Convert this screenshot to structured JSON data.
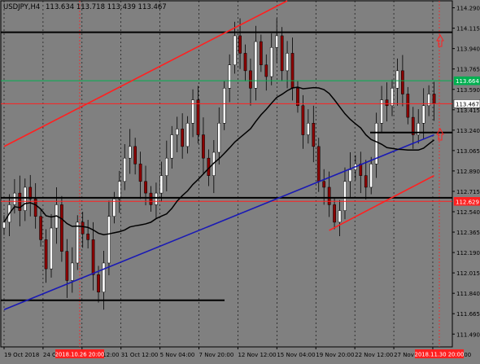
{
  "header": {
    "title": "USDJPY,H4",
    "ohlc": "113.634 113.718 113.439 113.467"
  },
  "chart_data": {
    "type": "candlestick",
    "symbol": "USDJPY",
    "timeframe": "H4",
    "ylim": [
      111.38,
      114.35
    ],
    "y_ticks": [
      "114.290",
      "114.115",
      "113.940",
      "113.765",
      "113.590",
      "113.415",
      "113.240",
      "113.065",
      "112.890",
      "112.715",
      "112.540",
      "112.365",
      "112.190",
      "112.015",
      "111.840",
      "111.665",
      "111.490"
    ],
    "x_ticks": [
      "19 Oct 2018",
      "24 Oct 20:00",
      "29 Oct 12:00",
      "31 Oct 12:00",
      "5 Nov 04:00",
      "7 Nov 20:00",
      "12 Nov 12:00",
      "15 Nov 04:00",
      "19 Nov 20:00",
      "22 Nov 12:00",
      "27 Nov 04:00",
      "29 Nov 20:00"
    ],
    "highlighted_x": [
      "2018.10.26 20:00",
      "2018.11.30 20:00"
    ],
    "price_labels": [
      {
        "value": 113.664,
        "text": "113.664",
        "color": "#00b050"
      },
      {
        "value": 113.467,
        "text": "113.467",
        "color": "#ffffff"
      },
      {
        "value": 112.629,
        "text": "112.629",
        "color": "#ff2020"
      }
    ],
    "closes": [
      112.45,
      112.6,
      112.7,
      112.55,
      112.75,
      112.65,
      112.5,
      112.3,
      112.05,
      112.4,
      112.6,
      112.2,
      111.95,
      112.1,
      112.45,
      112.35,
      112.3,
      112.0,
      111.85,
      112.1,
      112.5,
      112.65,
      112.8,
      113.0,
      113.1,
      112.95,
      112.8,
      112.7,
      112.6,
      112.7,
      112.85,
      113.0,
      113.2,
      113.25,
      113.1,
      113.3,
      113.5,
      113.2,
      113.0,
      112.85,
      113.05,
      113.3,
      113.6,
      113.8,
      114.05,
      113.9,
      113.75,
      113.6,
      114.0,
      113.8,
      113.7,
      113.95,
      114.05,
      113.75,
      113.9,
      113.6,
      113.45,
      113.2,
      113.3,
      113.1,
      112.8,
      112.75,
      112.6,
      112.45,
      112.55,
      112.8,
      112.9,
      112.95,
      112.85,
      112.75,
      112.95,
      113.3,
      113.5,
      113.45,
      113.6,
      113.75,
      113.55,
      113.35,
      113.2,
      113.3,
      113.45,
      113.55,
      113.47
    ],
    "trendlines": [
      {
        "name": "upper-channel",
        "color": "#ff2020",
        "points": [
          [
            0,
            113.1
          ],
          [
            54,
            114.35
          ]
        ]
      },
      {
        "name": "lower-channel",
        "color": "#ff2020",
        "points": [
          [
            62,
            112.38
          ],
          [
            82,
            112.85
          ]
        ]
      },
      {
        "name": "support",
        "color": "#1a1ab4",
        "points": [
          [
            0,
            111.7
          ],
          [
            82,
            113.2
          ]
        ]
      }
    ],
    "horizontals": [
      {
        "value": 114.08,
        "color": "#000000"
      },
      {
        "value": 113.664,
        "color": "#00b050"
      },
      {
        "value": 113.467,
        "color": "#ff2020"
      },
      {
        "value": 112.629,
        "color": "#ff2020"
      },
      {
        "value": 112.66,
        "color": "#000000"
      },
      {
        "value": 111.78,
        "color": "#000000"
      },
      {
        "value": 113.22,
        "color": "#000000"
      }
    ]
  }
}
